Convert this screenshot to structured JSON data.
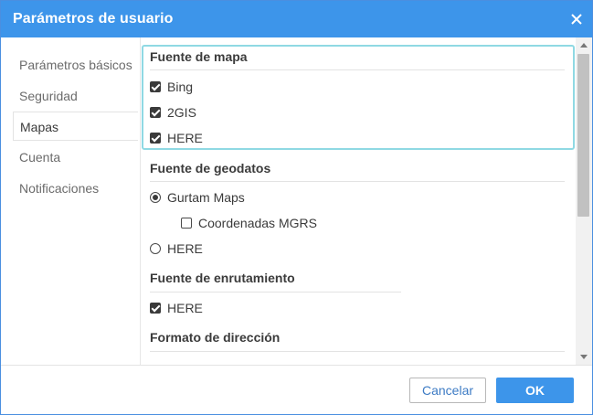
{
  "dialog": {
    "title": "Parámetros de usuario"
  },
  "sidebar": {
    "items": [
      {
        "label": "Parámetros básicos"
      },
      {
        "label": "Seguridad"
      },
      {
        "label": "Mapas"
      },
      {
        "label": "Cuenta"
      },
      {
        "label": "Notificaciones"
      }
    ],
    "active": "Mapas"
  },
  "map_source": {
    "title": "Fuente de mapa",
    "options": [
      {
        "label": "Bing",
        "checked": true
      },
      {
        "label": "2GIS",
        "checked": true
      },
      {
        "label": "HERE",
        "checked": true
      }
    ]
  },
  "geodata_source": {
    "title": "Fuente de geodatos",
    "gurtam": {
      "label": "Gurtam Maps",
      "selected": true
    },
    "mgrs": {
      "label": "Coordenadas MGRS",
      "checked": false
    },
    "here": {
      "label": "HERE",
      "selected": false
    }
  },
  "routing_source": {
    "title": "Fuente de enrutamiento",
    "options": [
      {
        "label": "HERE",
        "checked": true
      }
    ]
  },
  "address_format": {
    "title": "Formato de dirección"
  },
  "footer": {
    "cancel_label": "Cancelar",
    "ok_label": "OK"
  },
  "colors": {
    "accent": "#3d95ea",
    "focus_outline": "#8fd9e3"
  }
}
